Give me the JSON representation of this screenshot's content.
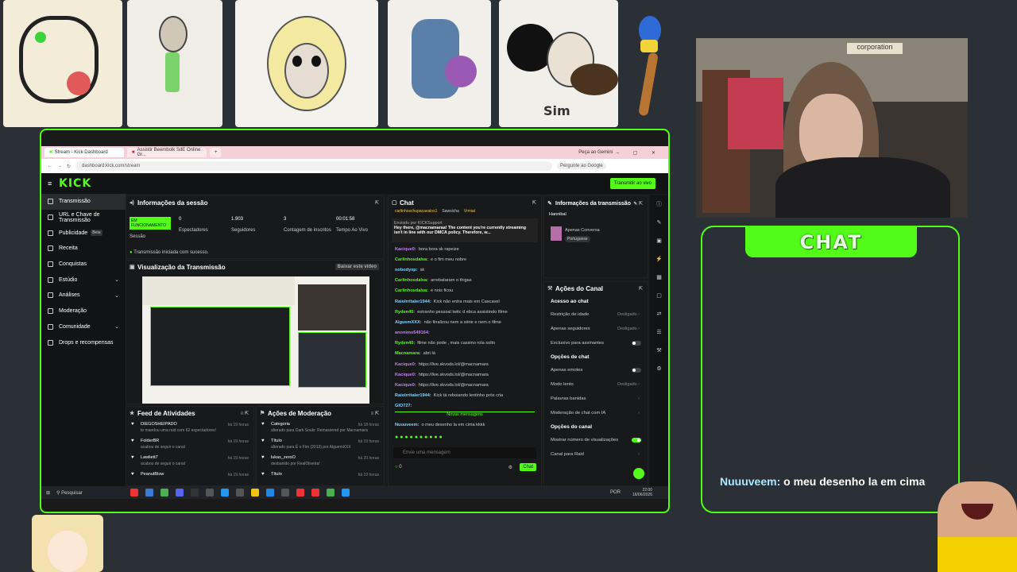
{
  "art_caption": "Sim",
  "chat_overlay": {
    "title": "CHAT",
    "message_user": "Nuuuveem:",
    "message_text": "o meu desenho la em cima"
  },
  "browser": {
    "tabs": [
      "Stream - Kick Dashboard",
      "Assistir Beembolk SdE Online Gr...",
      "+"
    ],
    "url": "dashboard.kick.com/stream",
    "ask_gemini": "Peça ao Gemini",
    "search_hint": "Pergunte ao Google"
  },
  "kick": {
    "logo": "KICK",
    "go_live": "Transmitir ao vivo",
    "sidebar": [
      {
        "label": "Transmissão",
        "selected": true
      },
      {
        "label": "URL e Chave de Transmissão"
      },
      {
        "label": "Publicidade",
        "badge": "Beta"
      },
      {
        "label": "Receita"
      },
      {
        "label": "Conquistas"
      },
      {
        "label": "Estúdio",
        "chevron": true
      },
      {
        "label": "Análises",
        "chevron": true
      },
      {
        "label": "Moderação"
      },
      {
        "label": "Comunidade",
        "chevron": true
      },
      {
        "label": "Drops e recompensas"
      }
    ],
    "session": {
      "title": "Informações da sessão",
      "status": "EM FUNCIONAMENTO",
      "status_label": "Sessão",
      "stats": [
        {
          "value": "0",
          "label": "Espectadores"
        },
        {
          "value": "1.903",
          "label": "Seguidores"
        },
        {
          "value": "3",
          "label": "Contagem de inscritos"
        },
        {
          "value": "00:01:58",
          "label": "Tempo Ao Vivo"
        }
      ],
      "notice": "Transmissão iniciada com sucesso."
    },
    "preview": {
      "title": "Visualização da Transmissão",
      "button": "Baixar este vídeo"
    },
    "feed": {
      "title": "Feed de Atividades",
      "items": [
        {
          "name": "DIEGOSHEIPADO",
          "sub": "te mandou uma raid com 62 espectadores!",
          "time": "há 19 horas"
        },
        {
          "name": "FolderBR",
          "sub": "acabou de seguir o canal",
          "time": "há 19 horas"
        },
        {
          "name": "Lawliett7",
          "sub": "acabou de seguir o canal",
          "time": "há 19 horas"
        },
        {
          "name": "PeanutBlow",
          "sub": "",
          "time": "há 19 horas"
        }
      ]
    },
    "moderation": {
      "title": "Ações de Moderação",
      "items": [
        {
          "name": "Categoria",
          "sub": "alterado para Dark Souls: Remastered por Macnamara",
          "time": "há 18 horas"
        },
        {
          "name": "Título",
          "sub": "alterado para É o Fim (2013) por AlguemXXX",
          "time": "há 19 horas"
        },
        {
          "name": "lukas_zeroO",
          "sub": "desbanido por RealOliveira!",
          "time": "há 20 horas"
        },
        {
          "name": "Título",
          "sub": "",
          "time": "há 19 horas"
        }
      ]
    },
    "chat": {
      "title": "Chat",
      "pinned_users": [
        "carlinhoschupacavalos1",
        "Sawsicha",
        "Vrmiat"
      ],
      "pinned_by": "Enviado por KICKSupport",
      "pinned_text": "Hey there, @macnamaraa! The content you're currently streaming isn't in line with our DMCA policy. Therefore, w...",
      "messages": [
        {
          "user": "Kacique0:",
          "text": "bora bora sk rapeize",
          "color": "#c77dff"
        },
        {
          "user": "Carlinhosdalva:",
          "text": "e o fim meu nobre",
          "color": "#53fc18"
        },
        {
          "user": "nobodyxp:",
          "text": "sk",
          "color": "#7fd4ff"
        },
        {
          "user": "Carlinhosdalva:",
          "text": "arrebataram o thigas",
          "color": "#53fc18"
        },
        {
          "user": "Carlinhosdalva:",
          "text": "e nois ficou",
          "color": "#53fc18"
        },
        {
          "user": "Raiolrritaler1944:",
          "text": "Kick não entra mais em Cascavel",
          "color": "#7fd4ff"
        },
        {
          "user": "Ryden40:",
          "text": "estranho pessoal twitc d ebca assistindo filme",
          "color": "#53fc18"
        },
        {
          "user": "AlguemXXX:",
          "text": "não finalizou nem a série e nem o filme",
          "color": "#7fd4ff"
        },
        {
          "user": "anonimo549164:",
          "text": "",
          "color": "#c77dff"
        },
        {
          "user": "Ryden40:",
          "text": "filme não pode , mais cassino rola solto",
          "color": "#53fc18"
        },
        {
          "user": "Macnamara:",
          "text": "abri lá",
          "color": "#53fc18"
        },
        {
          "user": "Kacique0:",
          "text": "https://live.skvods.lol/@macnamara",
          "color": "#c77dff"
        },
        {
          "user": "Kacique0:",
          "text": "https://live.skvods.lol/@macnamara",
          "color": "#c77dff"
        },
        {
          "user": "Kacique0:",
          "text": "https://live.skvods.lol/@macnamara",
          "color": "#c77dff"
        },
        {
          "user": "Raiolrritaler1944:",
          "text": "Kick tá reboiando lentinho prós cria",
          "color": "#7fd4ff"
        },
        {
          "user": "GIO727:",
          "text": "",
          "color": "#7fd4ff"
        }
      ],
      "new_messages": "Novas mensagens",
      "last_user": "Nuuuveem:",
      "last_text": "o meu desenho la em cima kkkk",
      "placeholder": "Envie uma mensagem",
      "count": "0",
      "send": "Chat"
    },
    "broadcast_info": {
      "title": "Informações da transmissão",
      "user": "Hannibal",
      "category": "Apenas Conversa",
      "lang": "Portuguese"
    },
    "channel_actions": {
      "title": "Ações do Canal",
      "chat_access": "Acesso ao chat",
      "rows1": [
        {
          "label": "Restrição de idade",
          "value": "Desligado"
        },
        {
          "label": "Apenas seguidores",
          "value": "Desligado"
        },
        {
          "label": "Exclusivo para assinantes",
          "toggle": false
        }
      ],
      "chat_options": "Opções de chat",
      "rows2": [
        {
          "label": "Apenas emotes",
          "toggle": false
        },
        {
          "label": "Modo lento",
          "value": "Desligado"
        },
        {
          "label": "Palavras banidas",
          "value": ""
        },
        {
          "label": "Moderação de chat com IA",
          "value": ""
        }
      ],
      "channel_options": "Opções do canal",
      "rows3": [
        {
          "label": "Mostrar número de visualizações",
          "toggle": true
        },
        {
          "label": "Canal para Raid",
          "value": ""
        }
      ]
    },
    "taskbar": {
      "search": "Pesquisar",
      "lang": "POR",
      "time": "22:00",
      "date": "16/06/2026"
    }
  }
}
